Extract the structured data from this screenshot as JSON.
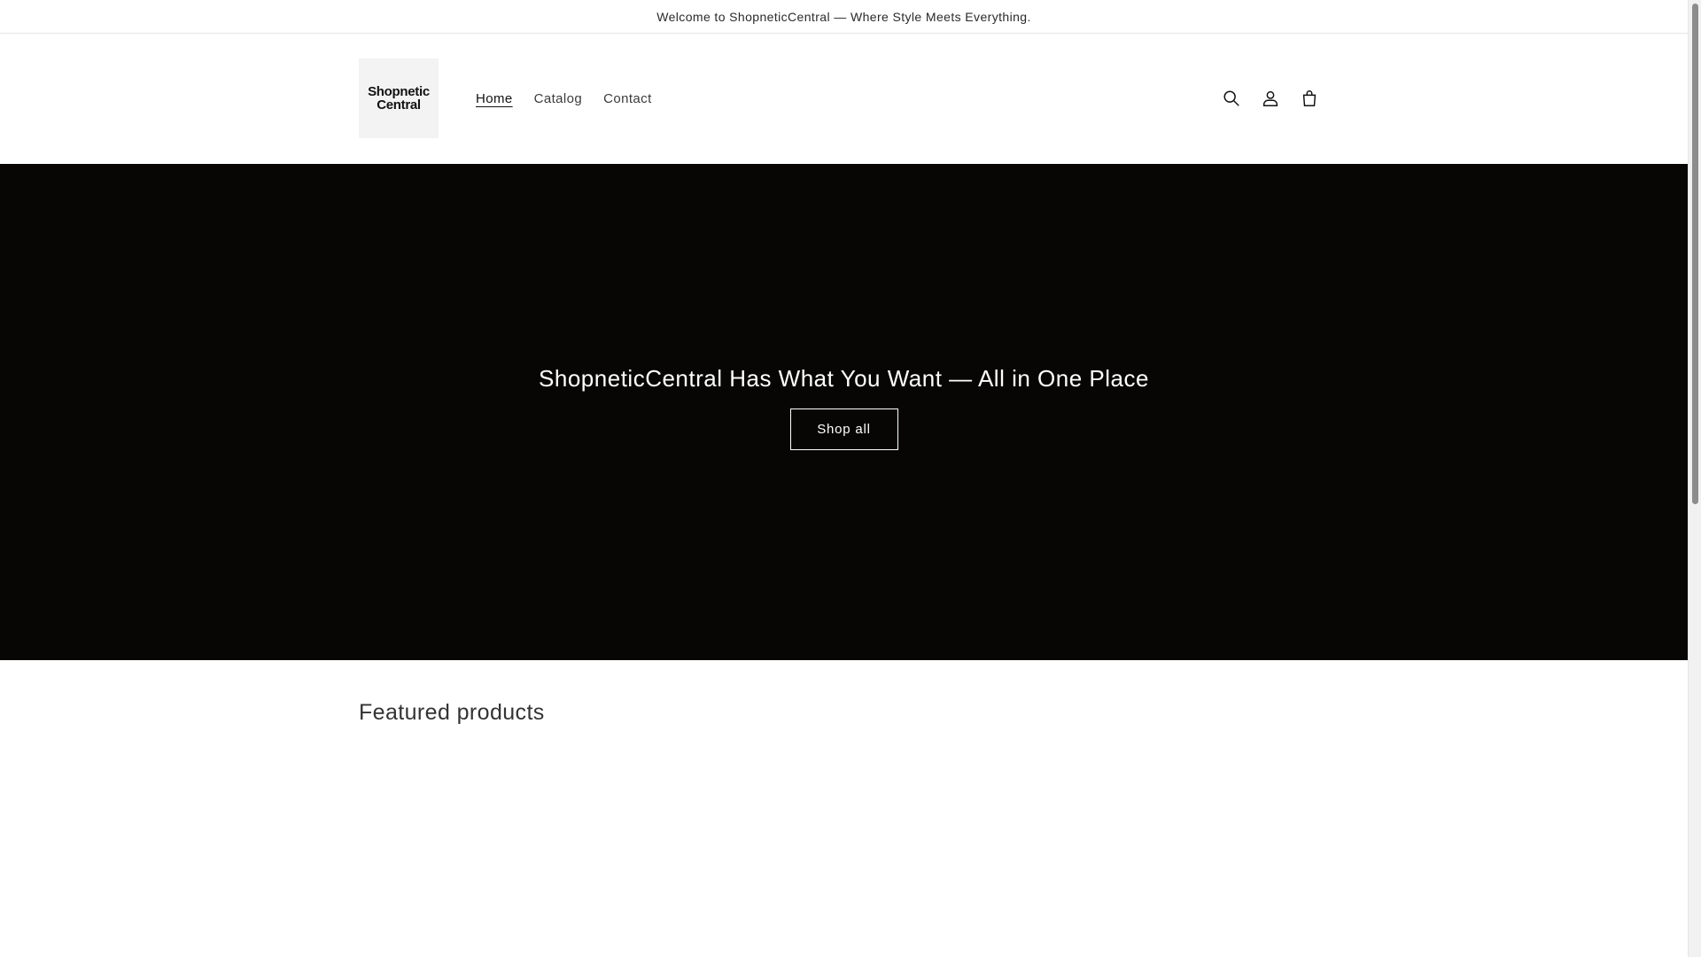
{
  "announcement": {
    "text": "Welcome to ShopneticCentral — Where Style Meets Everything."
  },
  "header": {
    "logo": {
      "line1": "Shopnetic",
      "line2": "Central"
    },
    "nav": [
      {
        "label": "Home",
        "active": true
      },
      {
        "label": "Catalog",
        "active": false
      },
      {
        "label": "Contact",
        "active": false
      }
    ],
    "icons": [
      "search-icon",
      "account-icon",
      "cart-icon"
    ]
  },
  "hero": {
    "title": "ShopneticCentral Has What You Want — All in One Place",
    "button_label": "Shop all",
    "background": "#070604"
  },
  "featured": {
    "title": "Featured products"
  }
}
